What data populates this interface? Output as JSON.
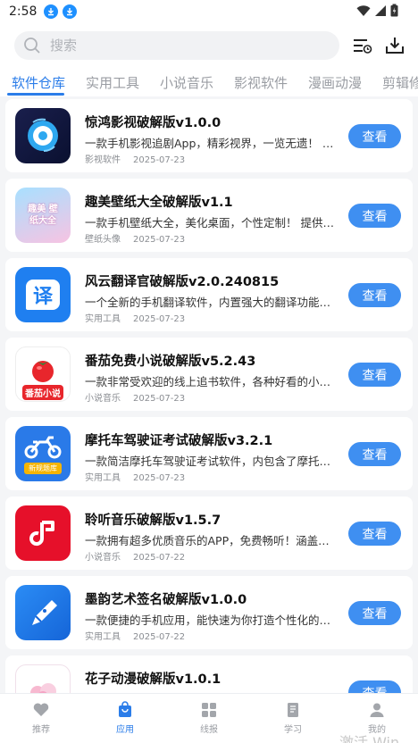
{
  "status_bar": {
    "time": "2:58"
  },
  "search": {
    "placeholder": "搜索"
  },
  "header_icons": [
    "task-list-icon",
    "download-icon"
  ],
  "tabs": [
    {
      "label": "软件仓库",
      "active": true
    },
    {
      "label": "实用工具",
      "active": false
    },
    {
      "label": "小说音乐",
      "active": false
    },
    {
      "label": "影视软件",
      "active": false
    },
    {
      "label": "漫画动漫",
      "active": false
    },
    {
      "label": "剪辑修",
      "active": false
    }
  ],
  "apps": [
    {
      "title": "惊鸿影视破解版v1.0.0",
      "desc": "一款手机影视追剧App，精彩视界，一览无遗！ 提供...",
      "category": "影视软件",
      "date": "2025-07-23",
      "button": "查看",
      "icon": "film-reel-icon"
    },
    {
      "title": "趣美壁纸大全破解版v1.1",
      "desc": "一款手机壁纸大全，美化桌面，个性定制！ 提供丰富...",
      "category": "壁纸头像",
      "date": "2025-07-23",
      "button": "查看",
      "icon": "wallpaper-app-icon",
      "icon_text": "趣美 壁纸大全"
    },
    {
      "title": "风云翻译官破解版v2.0.240815",
      "desc": "一个全新的手机翻译软件，内置强大的翻译功能，...",
      "category": "实用工具",
      "date": "2025-07-23",
      "button": "查看",
      "icon": "translate-icon",
      "icon_text": "译"
    },
    {
      "title": "番茄免费小说破解版v5.2.43",
      "desc": "一款非常受欢迎的线上追书软件，各种好看的小说...",
      "category": "小说音乐",
      "date": "2025-07-23",
      "button": "查看",
      "icon": "tomato-novel-icon",
      "icon_text": "番茄小说"
    },
    {
      "title": "摩托车驾驶证考试破解版v3.2.1",
      "desc": "一款简洁摩托车驾驶证考试软件，内包含了摩托车...",
      "category": "实用工具",
      "date": "2025-07-23",
      "button": "查看",
      "icon": "motorcycle-icon",
      "icon_text": "新规题库"
    },
    {
      "title": "聆听音乐破解版v1.5.7",
      "desc": "一款拥有超多优质音乐的APP，免费畅听！涵盖各种...",
      "category": "小说音乐",
      "date": "2025-07-22",
      "button": "查看",
      "icon": "music-note-icon"
    },
    {
      "title": "墨韵艺术签名破解版v1.0.0",
      "desc": "一款便捷的手机应用，能快速为你打造个性化的艺...",
      "category": "实用工具",
      "date": "2025-07-22",
      "button": "查看",
      "icon": "fountain-pen-icon"
    },
    {
      "title": "花子动漫破解版v1.0.1",
      "desc": "",
      "category": "",
      "date": "",
      "button": "查看",
      "icon": "anime-icon"
    }
  ],
  "bottom_nav": [
    {
      "label": "推荐",
      "icon": "heart-icon",
      "active": false
    },
    {
      "label": "应用",
      "icon": "bag-icon",
      "active": true
    },
    {
      "label": "线报",
      "icon": "grid-icon",
      "active": false
    },
    {
      "label": "学习",
      "icon": "book-icon",
      "active": false
    },
    {
      "label": "我的",
      "icon": "user-icon",
      "active": false
    }
  ],
  "watermark": "激活 Win",
  "colors": {
    "accent": "#2b7de9",
    "button": "#3f8ff1",
    "background": "#f4f5f7"
  }
}
